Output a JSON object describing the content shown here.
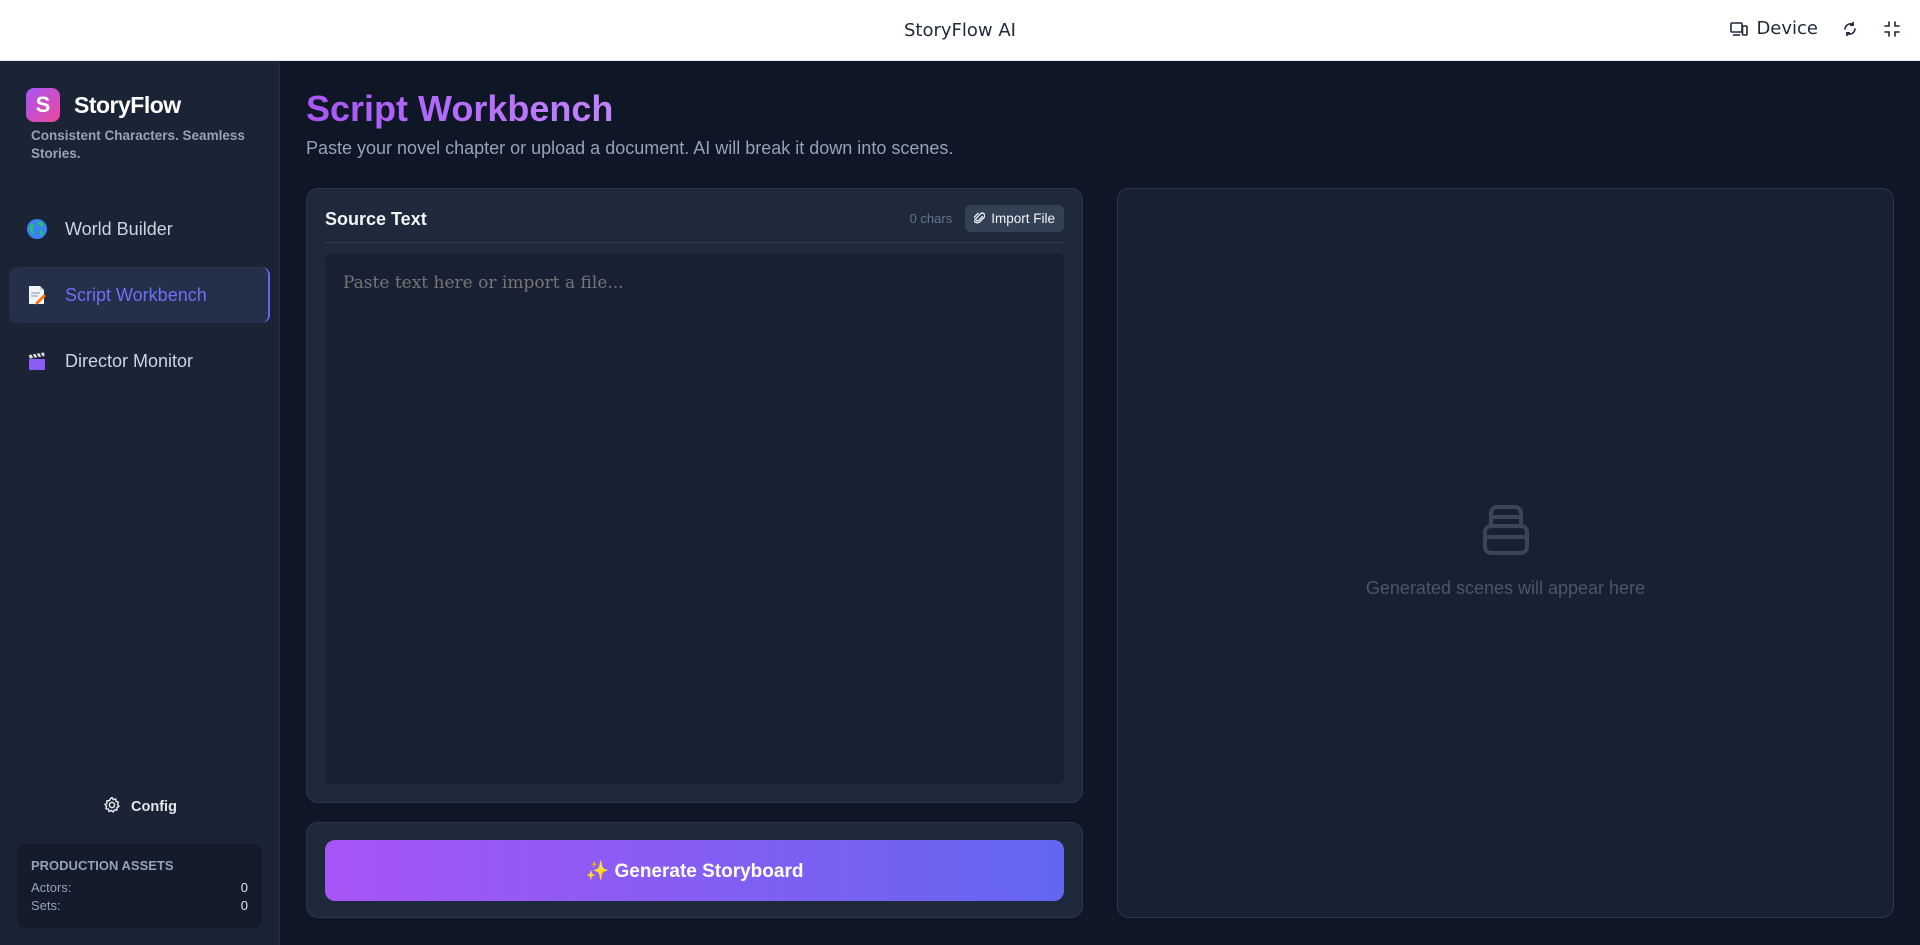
{
  "topbar": {
    "title": "StoryFlow AI",
    "device_label": "Device",
    "icons": [
      "device-icon",
      "rotate-icon",
      "collapse-icon"
    ]
  },
  "sidebar": {
    "brand_letter": "S",
    "brand_name": "StoryFlow",
    "tagline": "Consistent Characters. Seamless Stories.",
    "items": [
      {
        "label": "World Builder",
        "icon": "globe-icon",
        "active": false
      },
      {
        "label": "Script Workbench",
        "icon": "memo-icon",
        "active": true
      },
      {
        "label": "Director Monitor",
        "icon": "clapper-icon",
        "active": false
      }
    ],
    "config_label": "Config",
    "assets": {
      "title": "PRODUCTION ASSETS",
      "actors_label": "Actors:",
      "actors_value": "0",
      "sets_label": "Sets:",
      "sets_value": "0"
    }
  },
  "main": {
    "title": "Script Workbench",
    "subtitle": "Paste your novel chapter or upload a document. AI will break it down into scenes.",
    "source": {
      "title": "Source Text",
      "char_count": "0 chars",
      "import_label": "Import File",
      "placeholder": "Paste text here or import a file...",
      "value": ""
    },
    "generate_label": "✨ Generate Storyboard",
    "scenes_empty_text": "Generated scenes will appear here"
  },
  "colors": {
    "accent_purple": "#a855f7",
    "accent_indigo": "#6366f1",
    "background": "#0f1626",
    "panel": "#1e293b"
  }
}
